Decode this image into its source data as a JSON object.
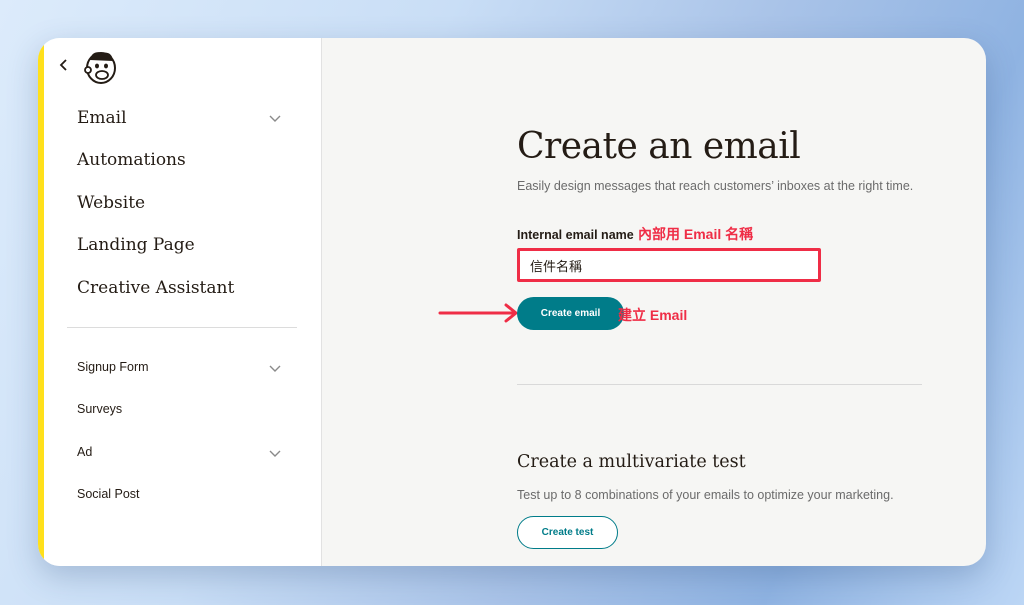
{
  "sidebar": {
    "main_items": [
      {
        "label": "Email",
        "has_chevron": true
      },
      {
        "label": "Automations",
        "has_chevron": false
      },
      {
        "label": "Website",
        "has_chevron": false
      },
      {
        "label": "Landing Page",
        "has_chevron": false
      },
      {
        "label": "Creative Assistant",
        "has_chevron": false
      }
    ],
    "sub_items": [
      {
        "label": "Signup Form",
        "has_chevron": true
      },
      {
        "label": "Surveys",
        "has_chevron": false
      },
      {
        "label": "Ad",
        "has_chevron": true
      },
      {
        "label": "Social Post",
        "has_chevron": false
      }
    ],
    "icons": {
      "back": "chevron-left-icon",
      "logo": "mailchimp-freddie-logo",
      "expand": "chevron-down-icon"
    }
  },
  "main": {
    "title": "Create an email",
    "subtitle": "Easily design messages that reach customers’ inboxes at the right time.",
    "field_label": "Internal email name",
    "field_annotation": "內部用 Email 名稱",
    "field_value": "信件名稱",
    "create_button": "Create email",
    "button_annotation": "建立 Email",
    "multivariate_title": "Create a multivariate test",
    "multivariate_desc": "Test up to 8 combinations of your emails to optimize your marketing.",
    "test_button": "Create test"
  },
  "colors": {
    "accent_yellow": "#ffe01b",
    "teal": "#007c89",
    "annotation_red": "#ef2d46",
    "text_dark": "#241c15"
  }
}
